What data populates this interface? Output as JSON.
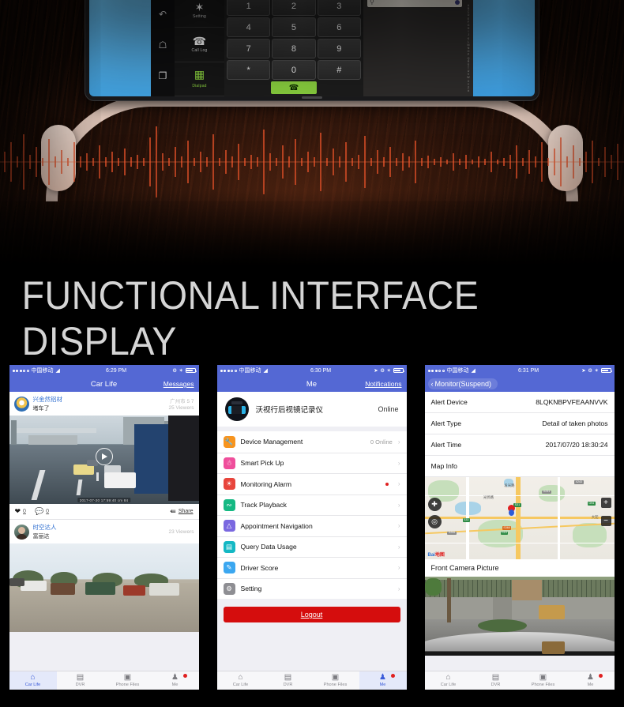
{
  "banner": {
    "title": "FUNCTIONAL INTERFACE DISPLAY",
    "device": {
      "nav_icons": [
        "back-icon",
        "home-icon",
        "recents-icon"
      ],
      "menu": [
        {
          "label": "Setting",
          "icon": "bluetooth-icon",
          "active": false
        },
        {
          "label": "Call Log",
          "icon": "call-log-icon",
          "active": false
        },
        {
          "label": "Dialpad",
          "icon": "dialpad-icon",
          "active": true
        }
      ],
      "keys": [
        [
          "1",
          "2",
          "3"
        ],
        [
          "4",
          "5",
          "6"
        ],
        [
          "7",
          "8",
          "9"
        ],
        [
          "*",
          "0",
          "#"
        ]
      ],
      "call_icon": "phone-icon",
      "backspace_icon": "backspace-icon",
      "search_icon": "search-icon",
      "az_index": "ABCDEFGHIJKLMNOPQRSTUVWXYZ#"
    }
  },
  "phones": [
    {
      "status": {
        "carrier": "中国移动",
        "time": "6:29 PM",
        "wifi_icon": "wifi-icon",
        "battery_icon": "battery-icon"
      },
      "nav": {
        "title": "Car Life",
        "right": "Messages"
      },
      "posts": [
        {
          "name": "兴金然铝材",
          "subtitle": "堵车了",
          "location": "广州市 5 7",
          "viewers": "25 Viewers",
          "timestamp": "2017-07-20 17:59:40 cm 84",
          "media_type": "video",
          "likes": "0",
          "comments": "0",
          "share": "Share"
        },
        {
          "name": "时空达人",
          "subtitle": "富丽达",
          "location": "",
          "viewers": "23 Viewers",
          "timestamp": "",
          "media_type": "photo",
          "likes": "",
          "comments": "",
          "share": ""
        }
      ],
      "tabs": [
        {
          "label": "Car Life",
          "icon": "home-icon",
          "active": true,
          "badge": false
        },
        {
          "label": "DVR",
          "icon": "camcorder-icon",
          "active": false,
          "badge": false
        },
        {
          "label": "Phone Files",
          "icon": "photo-icon",
          "active": false,
          "badge": false
        },
        {
          "label": "Me",
          "icon": "person-icon",
          "active": false,
          "badge": true
        }
      ]
    },
    {
      "status": {
        "carrier": "中国移动",
        "time": "6:30 PM",
        "wifi_icon": "wifi-icon",
        "battery_icon": "battery-icon"
      },
      "nav": {
        "title": "Me",
        "right": "Notifications"
      },
      "profile": {
        "name": "沃视行后视镜记录仪",
        "status": "Online"
      },
      "menu": [
        {
          "label": "Device Management",
          "value": "0 Online",
          "icon": "wrench-icon",
          "color": "#f7941e",
          "dot": false
        },
        {
          "label": "Smart  Pick Up",
          "value": "",
          "icon": "hands-icon",
          "color": "#ef4e9b",
          "dot": false
        },
        {
          "label": "Monitoring Alarm",
          "value": "",
          "icon": "alarm-icon",
          "color": "#e8453c",
          "dot": true
        },
        {
          "label": "Track Playback",
          "value": "",
          "icon": "track-icon",
          "color": "#15b983",
          "dot": false
        },
        {
          "label": "Appointment Navigation",
          "value": "",
          "icon": "navigation-icon",
          "color": "#7a68e0",
          "dot": false
        },
        {
          "label": "Query Data Usage",
          "value": "",
          "icon": "data-usage-icon",
          "color": "#14b8c4",
          "dot": false
        },
        {
          "label": "Driver Score",
          "value": "",
          "icon": "score-icon",
          "color": "#3ba7f0",
          "dot": false
        },
        {
          "label": "Setting",
          "value": "",
          "icon": "gear-icon",
          "color": "#8e8e93",
          "dot": false
        }
      ],
      "logout": "Logout",
      "tabs": [
        {
          "label": "Car Life",
          "icon": "home-icon",
          "active": false,
          "badge": false
        },
        {
          "label": "DVR",
          "icon": "camcorder-icon",
          "active": false,
          "badge": false
        },
        {
          "label": "Phone Files",
          "icon": "photo-icon",
          "active": false,
          "badge": false
        },
        {
          "label": "Me",
          "icon": "person-icon",
          "active": true,
          "badge": true
        }
      ]
    },
    {
      "status": {
        "carrier": "中国移动",
        "time": "6:31 PM",
        "wifi_icon": "wifi-icon",
        "battery_icon": "battery-icon"
      },
      "nav": {
        "title": "Monitor(Suspend)",
        "back_icon": "chevron-left-icon"
      },
      "details": [
        {
          "key": "Alert Device",
          "value": "8LQKNBPVFEAANVVK"
        },
        {
          "key": "Alert Type",
          "value": "Detail of taken photos"
        },
        {
          "key": "Alert Time",
          "value": "2017/07/20 18:30:24"
        },
        {
          "key": "Map Info",
          "value": ""
        }
      ],
      "map": {
        "labels": [
          "光侨路",
          "发光路",
          "大犯",
          "X231",
          "X243",
          "X255",
          "S33",
          "S31",
          "G15",
          "G94",
          "S365"
        ],
        "attribution": "Bai 地图",
        "locate_icon": "crosshair-icon",
        "street_icon": "street-view-icon",
        "zoom_in": "+",
        "zoom_out": "−"
      },
      "caption": "Front Camera Picture",
      "tabs": [
        {
          "label": "Car Life",
          "icon": "home-icon",
          "active": false,
          "badge": false
        },
        {
          "label": "DVR",
          "icon": "camcorder-icon",
          "active": false,
          "badge": false
        },
        {
          "label": "Phone Files",
          "icon": "photo-icon",
          "active": false,
          "badge": false
        },
        {
          "label": "Me",
          "icon": "person-icon",
          "active": false,
          "badge": true
        }
      ]
    }
  ],
  "colors": {
    "header_blue": "#5468d4",
    "accent_red": "#d50d0d",
    "tab_active": "#3a5bd9",
    "call_green": "#8ad13f"
  }
}
